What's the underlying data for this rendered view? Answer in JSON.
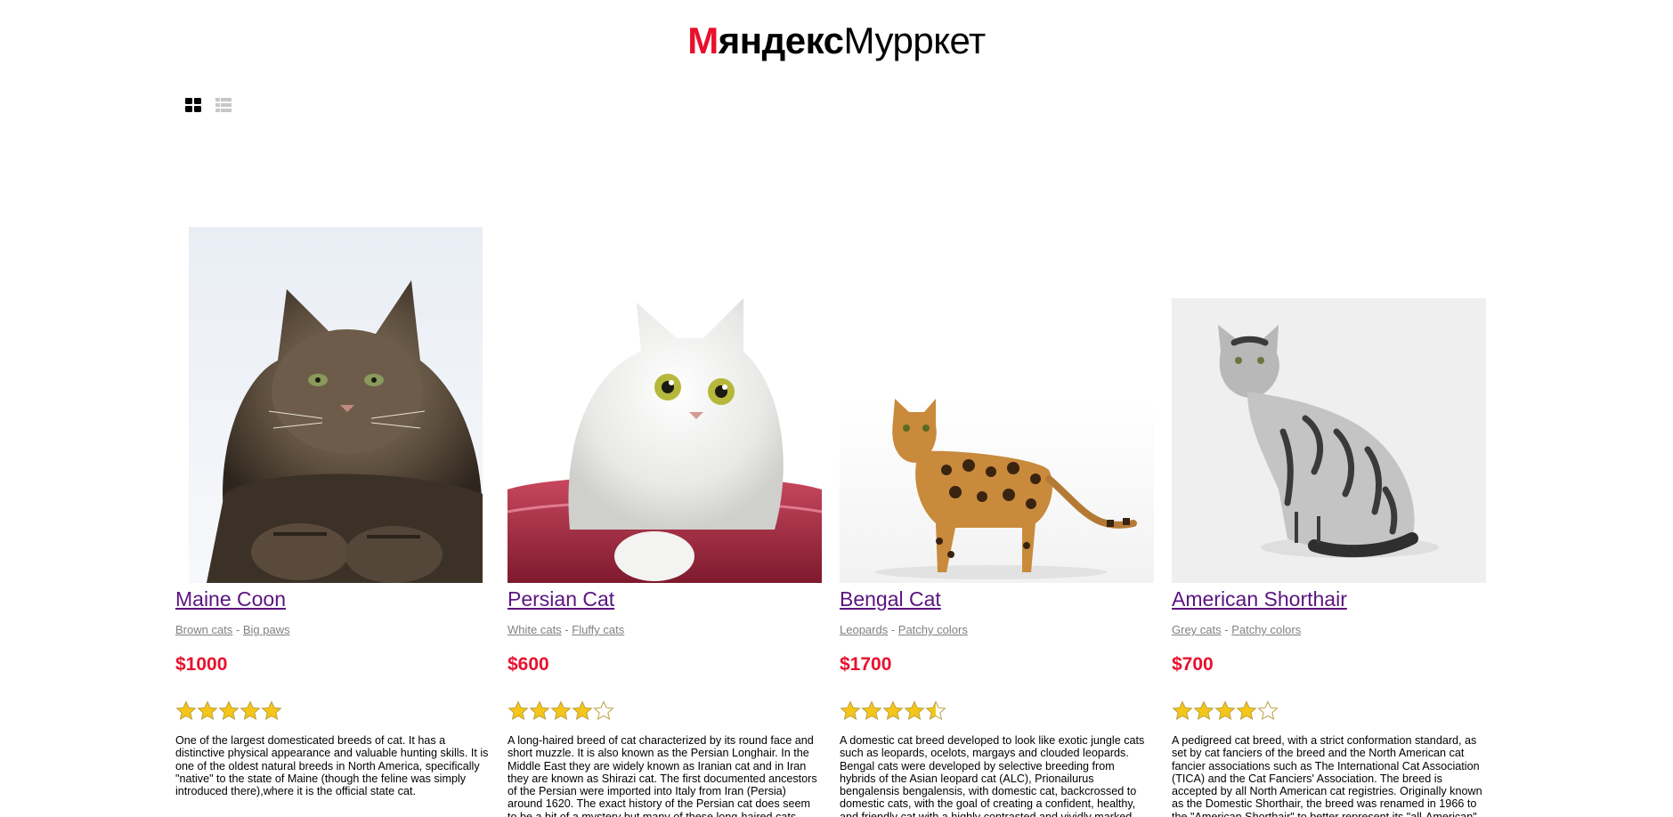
{
  "header": {
    "logo_m": "М",
    "logo_bold": "яндекс",
    "logo_rest": "Мурркет"
  },
  "view_toggle": {
    "grid_icon": "grid-view-icon",
    "list_icon": "list-view-icon",
    "active": "grid"
  },
  "colors": {
    "accent": "#e8112d",
    "link": "#5b1480",
    "tag": "#808080",
    "star": "#f5c518"
  },
  "products": [
    {
      "title": "Maine Coon",
      "tags": [
        "Brown cats",
        "Big paws"
      ],
      "tag_separator": " - ",
      "price": "$1000",
      "rating": 5,
      "description": "One of the largest domesticated breeds of cat. It has a distinctive physical appearance and valuable hunting skills. It is one of the oldest natural breeds in North America, specifically \"native\" to the state of Maine (though the feline was simply introduced there),where it is the official state cat.",
      "image_icon": "maine-coon-photo"
    },
    {
      "title": "Persian Cat",
      "tags": [
        "White cats",
        "Fluffy cats"
      ],
      "tag_separator": " - ",
      "price": "$600",
      "rating": 4,
      "description": "A long-haired breed of cat characterized by its round face and short muzzle. It is also known as the Persian Longhair. In the Middle East they are widely known as Iranian cat and in Iran they are known as Shirazi cat. The first documented ancestors of the Persian were imported into Italy from Iran (Persia) around 1620. The exact history of the Persian cat does seem to be a bit of a mystery but many of these long-haired cats were seen in",
      "image_icon": "persian-cat-photo"
    },
    {
      "title": "Bengal Cat",
      "tags": [
        "Leopards",
        "Patchy colors"
      ],
      "tag_separator": " - ",
      "price": "$1700",
      "rating": 4.5,
      "description": "A domestic cat breed developed to look like exotic jungle cats such as leopards, ocelots, margays and clouded leopards. Bengal cats were developed by selective breeding from hybrids of the Asian leopard cat (ALC), Prionailurus bengalensis bengalensis, with domestic cat, backcrossed to domestic cats, with the goal of creating a confident, healthy, and friendly cat with a highly contrasted and vividly marked coat.",
      "image_icon": "bengal-cat-photo"
    },
    {
      "title": "American Shorthair",
      "tags": [
        "Grey cats",
        "Patchy colors"
      ],
      "tag_separator": " - ",
      "price": "$700",
      "rating": 4,
      "description": "A pedigreed cat breed, with a strict conformation standard, as set by cat fanciers of the breed and the North American cat fancier associations such as The International Cat Association (TICA) and the Cat Fanciers' Association. The breed is accepted by all North American cat registries. Originally known as the Domestic Shorthair, the breed was renamed in 1966 to the \"American Shorthair\" to better represent its \"all-American\" origins and to",
      "image_icon": "american-shorthair-photo"
    }
  ]
}
